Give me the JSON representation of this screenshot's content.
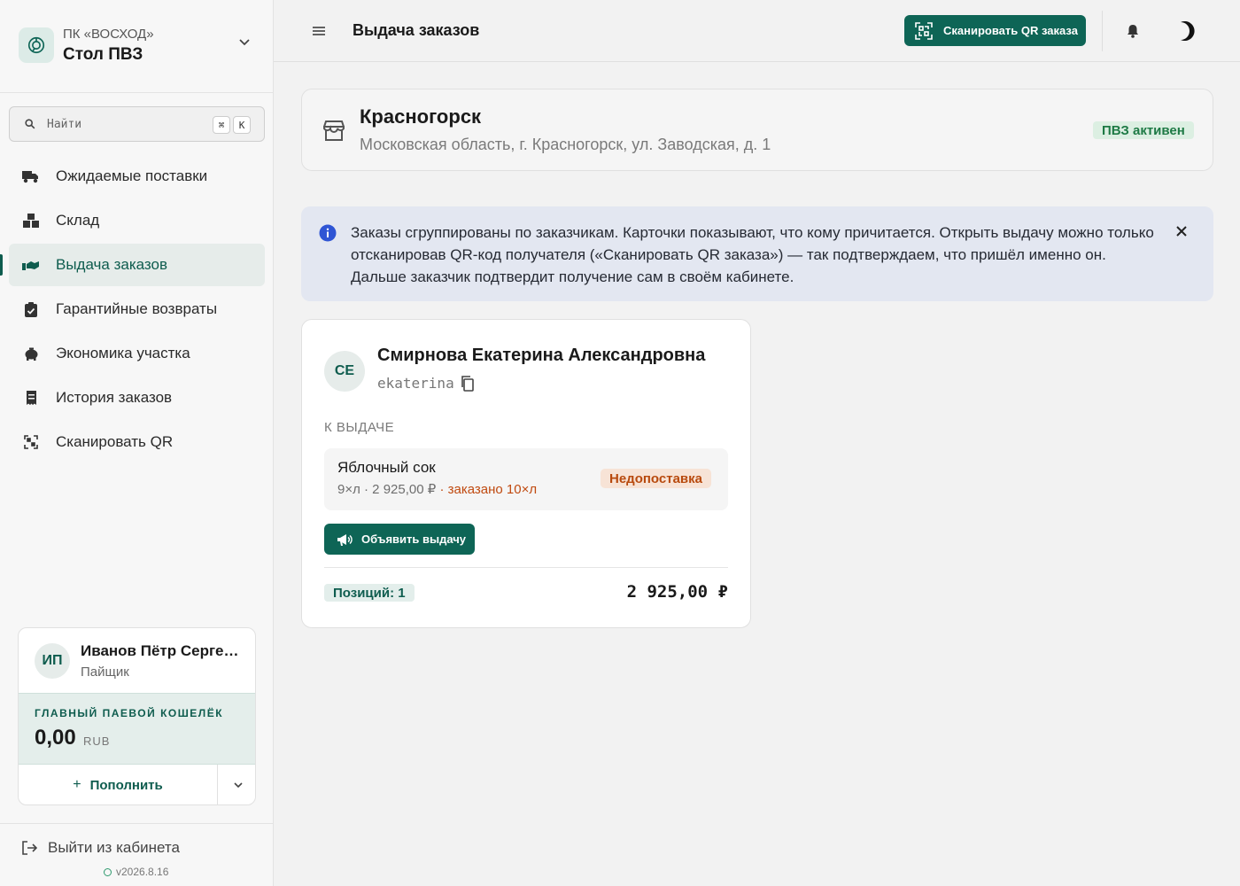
{
  "brand": {
    "org": "ПК «ВОСХОД»",
    "title": "Стол ПВЗ"
  },
  "search": {
    "placeholder": "Найти",
    "kbd1": "⌘",
    "kbd2": "K"
  },
  "sidebar": {
    "items": [
      {
        "label": "Ожидаемые поставки",
        "icon": "truck-icon"
      },
      {
        "label": "Склад",
        "icon": "boxes-icon"
      },
      {
        "label": "Выдача заказов",
        "icon": "handover-icon",
        "active": true
      },
      {
        "label": "Гарантийные возвраты",
        "icon": "clipboard-check-icon"
      },
      {
        "label": "Экономика участка",
        "icon": "piggy-bank-icon"
      },
      {
        "label": "История заказов",
        "icon": "receipt-icon"
      },
      {
        "label": "Сканировать QR",
        "icon": "qr-scan-icon"
      }
    ]
  },
  "user": {
    "initials": "ИП",
    "name": "Иванов Пётр Сергеевич",
    "role": "Пайщик",
    "wallet_label": "ГЛАВНЫЙ ПАЕВОЙ КОШЕЛЁК",
    "wallet_amount": "0,00",
    "wallet_currency": "RUB",
    "topup_label": "Пополнить"
  },
  "footer": {
    "logout_label": "Выйти из кабинета",
    "version": "v2026.8.16"
  },
  "header": {
    "title": "Выдача заказов",
    "scan_label": "Сканировать QR заказа"
  },
  "location": {
    "title": "Красногорск",
    "address": "Московская область, г. Красногорск, ул. Заводская, д. 1",
    "status": "ПВЗ активен"
  },
  "info": {
    "text": "Заказы сгруппированы по заказчикам. Карточки показывают, что кому причитается. Открыть выдачу можно только отсканировав QR-код получателя («Сканировать QR заказа») — так подтверждаем, что пришёл именно он. Дальше заказчик подтвердит получение сам в своём кабинете."
  },
  "customer": {
    "initials": "СЕ",
    "name": "Смирнова Екатерина Александровна",
    "login": "ekaterina",
    "section_label": "К ВЫДАЧЕ",
    "items": [
      {
        "name": "Яблочный сок",
        "meta": "9×л · 2 925,00 ₽",
        "warn": " · заказано 10×л",
        "badge": "Недопоставка"
      }
    ],
    "announce_label": "Объявить выдачу",
    "positions": "Позиций: 1",
    "total": "2 925,00 ₽"
  },
  "colors": {
    "accent": "#0e6556",
    "warning": "#b84a0e",
    "success": "#1e7a45",
    "info_bg": "#e3e7f1"
  }
}
